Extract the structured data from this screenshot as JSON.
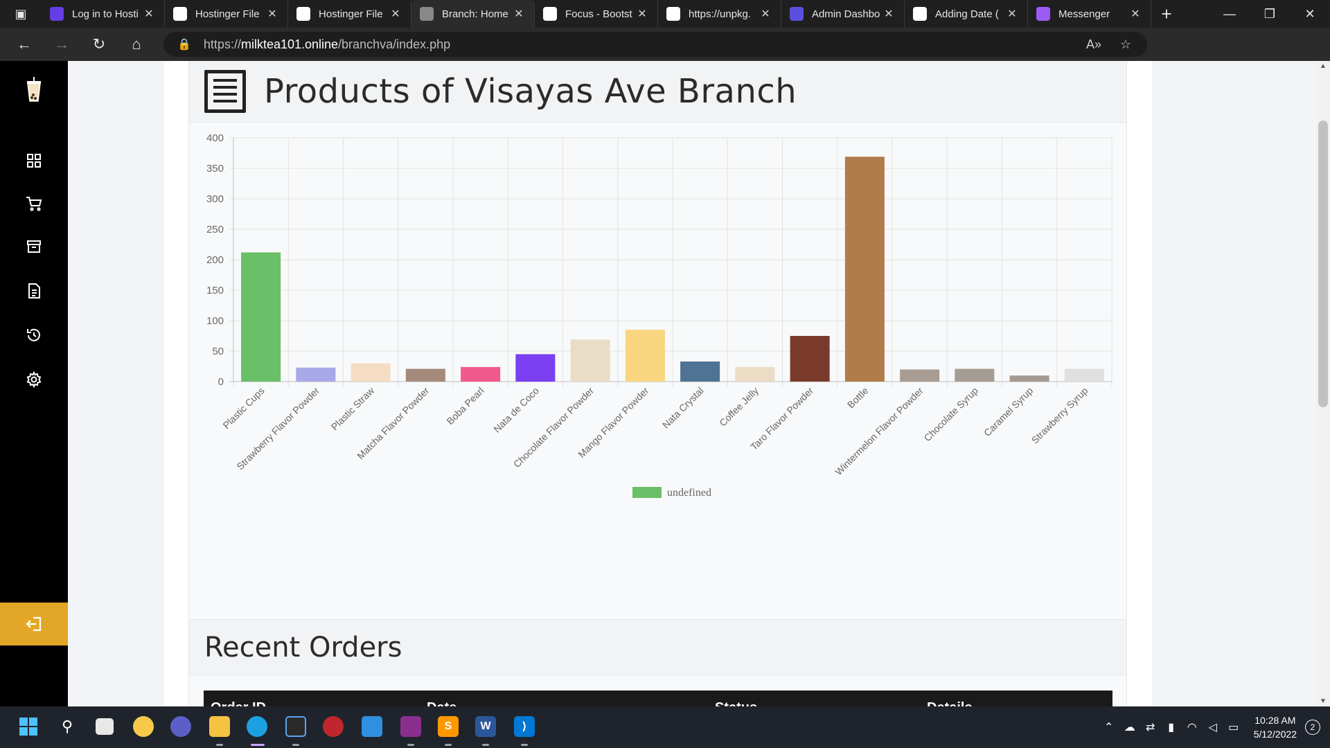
{
  "browser": {
    "tabs": [
      {
        "title": "Log in to Hosti",
        "favicon": "hostinger-icon",
        "color": "#673de6",
        "active": false
      },
      {
        "title": "Hostinger File",
        "favicon": "page-icon",
        "color": "#ffffff",
        "active": false
      },
      {
        "title": "Hostinger File",
        "favicon": "page-icon",
        "color": "#ffffff",
        "active": false
      },
      {
        "title": "Branch: Home",
        "favicon": "loading-icon",
        "color": "#888888",
        "active": true
      },
      {
        "title": "Focus - Bootst",
        "favicon": "blank-icon",
        "color": "#ffffff",
        "active": false
      },
      {
        "title": "https://unpkg.",
        "favicon": "unpkg-icon",
        "color": "#ffffff",
        "active": false
      },
      {
        "title": "Admin Dashbo",
        "favicon": "cl-icon",
        "color": "#5b4fe0",
        "active": false
      },
      {
        "title": "Adding Date (",
        "favicon": "p-icon",
        "color": "#ffffff",
        "active": false
      },
      {
        "title": "Messenger",
        "favicon": "messenger-icon",
        "color": "#9b5cf6",
        "active": false
      }
    ],
    "url_prefix": "https://",
    "url_host": "milktea101.online",
    "url_path": "/branchva/index.php"
  },
  "sidebar": {
    "items": [
      "logo-icon",
      "dashboard-icon",
      "cart-icon",
      "archive-icon",
      "document-icon",
      "history-icon",
      "settings-icon"
    ],
    "logout": "logout-icon",
    "accent": "#e2a727"
  },
  "products_card": {
    "title": "Products of Visayas Ave Branch"
  },
  "chart_data": {
    "type": "bar",
    "categories": [
      "Plastic Cups",
      "Strawberry Flavor Powder",
      "Plastic Straw",
      "Matcha Flavor Powder",
      "Boba Pearl",
      "Nata de Coco",
      "Chocolate Flavor Powder",
      "Mango Flavor Powder",
      "Nata Crystal",
      "Coffee Jelly",
      "Taro Flavor Powder",
      "Bottle",
      "Wintermelon Flavor Powder",
      "Chocolate Syrup",
      "Caramel Syrup",
      "Strawberry Syrup"
    ],
    "values": [
      212,
      23,
      30,
      21,
      24,
      45,
      69,
      85,
      33,
      24,
      75,
      369,
      20,
      21,
      10,
      21
    ],
    "colors": [
      "#6abf69",
      "#a7a9e8",
      "#f6dcc2",
      "#a58a7b",
      "#f25a8c",
      "#7b3ff2",
      "#e9ddc6",
      "#f9d580",
      "#4f7392",
      "#ecdcc5",
      "#7a3a2b",
      "#b07d4a",
      "#a99d93",
      "#a59c93",
      "#a59a91",
      "#e0e0e0"
    ],
    "legend": "undefined",
    "legend_color": "#6abf69",
    "ylim": [
      0,
      400
    ],
    "yticks": [
      0,
      50,
      100,
      150,
      200,
      250,
      300,
      350,
      400
    ],
    "grid": true,
    "legend_position": "bottom"
  },
  "orders_card": {
    "title": "Recent Orders",
    "columns": [
      "Order ID",
      "Date",
      "Status",
      "Details"
    ]
  },
  "taskbar": {
    "time": "10:28 AM",
    "date": "5/12/2022",
    "notifications": "2"
  }
}
